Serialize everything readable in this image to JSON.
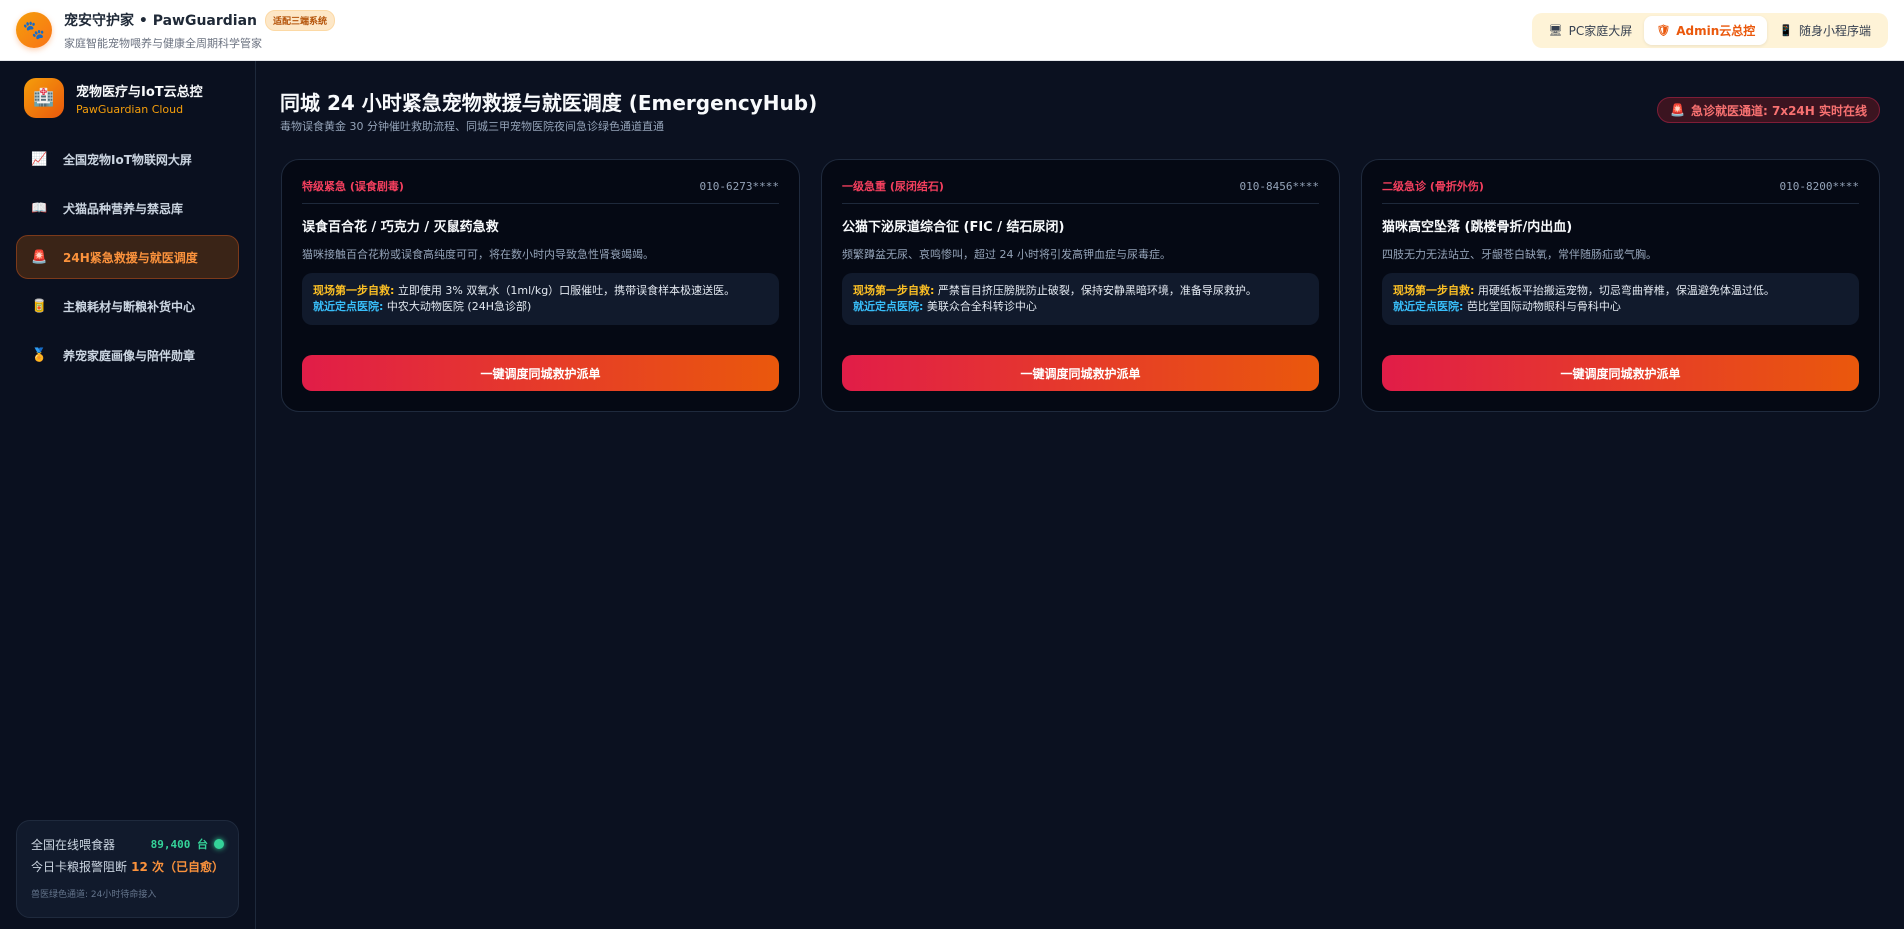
{
  "topbar": {
    "logo_icon": "paw-icon",
    "title": "宠安守护家 • PawGuardian",
    "badge": "适配三端系统",
    "subtitle": "家庭智能宠物喂养与健康全周期科学管家",
    "switcher": [
      {
        "icon": "🖥",
        "label": "PC家庭大屏"
      },
      {
        "icon": "🛡",
        "label": "Admin云总控"
      },
      {
        "icon": "📱",
        "label": "随身小程序端"
      }
    ]
  },
  "sidebar": {
    "logo_icon": "medical-box-icon",
    "title": "宠物医疗与IoT云总控",
    "subtitle": "PawGuardian Cloud",
    "items": [
      {
        "icon": "📈",
        "label": "全国宠物IoT物联网大屏"
      },
      {
        "icon": "📖",
        "label": "犬猫品种营养与禁忌库"
      },
      {
        "icon": "🚨",
        "label": "24H紧急救援与就医调度"
      },
      {
        "icon": "🥫",
        "label": "主粮耗材与断粮补货中心"
      },
      {
        "icon": "🏅",
        "label": "养宠家庭画像与陪伴勋章"
      }
    ],
    "stats": {
      "feeders_label": "全国在线喂食器",
      "feeders_value": "89,400 台",
      "alerts_label": "今日卡粮报警阻断",
      "alerts_value": "12 次（已自愈）",
      "note": "兽医绿色通道: 24小时待命接入"
    }
  },
  "main": {
    "title": "同城 24 小时紧急宠物救援与就医调度 (EmergencyHub)",
    "subtitle": "毒物误食黄金 30 分钟催吐救助流程、同城三甲宠物医院夜间急诊绿色通道直通",
    "hotline_icon": "🚨",
    "hotline": "急诊就医通道: 7x24H 实时在线",
    "first_aid_label": "现场第一步自救:",
    "hospital_label": "就近定点医院:",
    "cards": [
      {
        "level": "特级紧急 (误食剧毒)",
        "phone": "010-6273****",
        "title": "误食百合花 / 巧克力 / 灭鼠药急救",
        "desc": "猫咪接触百合花粉或误食高纯度可可，将在数小时内导致急性肾衰竭竭。",
        "first_aid": "立即使用 3% 双氧水（1ml/kg）口服催吐，携带误食样本极速送医。",
        "hospital": "中农大动物医院 (24H急诊部)",
        "button": "一键调度同城救护派单"
      },
      {
        "level": "一级急重 (尿闭结石)",
        "phone": "010-8456****",
        "title": "公猫下泌尿道综合征 (FIC / 结石尿闭)",
        "desc": "频繁蹲盆无尿、哀鸣惨叫，超过 24 小时将引发高钾血症与尿毒症。",
        "first_aid": "严禁盲目挤压膀胱防止破裂，保持安静黑暗环境，准备导尿救护。",
        "hospital": "美联众合全科转诊中心",
        "button": "一键调度同城救护派单"
      },
      {
        "level": "二级急诊 (骨折外伤)",
        "phone": "010-8200****",
        "title": "猫咪高空坠落 (跳楼骨折/内出血)",
        "desc": "四肢无力无法站立、牙龈苍白缺氧，常伴随肠疝或气胸。",
        "first_aid": "用硬纸板平抬搬运宠物，切忌弯曲脊椎，保温避免体温过低。",
        "hospital": "芭比堂国际动物眼科与骨科中心",
        "button": "一键调度同城救护派单"
      }
    ]
  }
}
